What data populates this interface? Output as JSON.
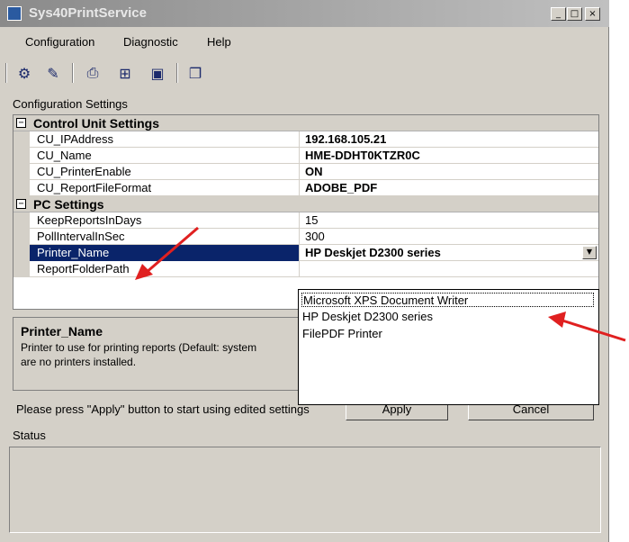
{
  "window": {
    "title": "Sys40PrintService"
  },
  "menu": [
    "Configuration",
    "Diagnostic",
    "Help"
  ],
  "toolbar": {
    "icons": [
      "settings-icon",
      "edit-icon",
      "print-icon",
      "network-icon",
      "device-icon",
      "report-icon"
    ]
  },
  "config": {
    "section_label": "Configuration Settings",
    "categories": [
      {
        "label": "Control Unit Settings",
        "toggle": "⊟",
        "properties": [
          {
            "name": "CU_IPAddress",
            "value": "192.168.105.21"
          },
          {
            "name": "CU_Name",
            "value": "HME-DDHT0KTZR0C"
          },
          {
            "name": "CU_PrinterEnable",
            "value": "ON"
          },
          {
            "name": "CU_ReportFileFormat",
            "value": "ADOBE_PDF"
          }
        ]
      },
      {
        "label": "PC Settings",
        "toggle": "⊟",
        "properties": [
          {
            "name": "KeepReportsInDays",
            "value": "15"
          },
          {
            "name": "PollIntervalInSec",
            "value": "300"
          },
          {
            "name": "Printer_Name",
            "value": "HP Deskjet D2300 series",
            "selected": true
          },
          {
            "name": "ReportFolderPath",
            "value": ""
          }
        ]
      }
    ]
  },
  "dropdown": {
    "options": [
      "Microsoft XPS Document Writer",
      "HP Deskjet D2300 series",
      "FilePDF Printer"
    ]
  },
  "description": {
    "title": "Printer_Name",
    "text_line1": "Printer to use for printing reports (Default: system",
    "text_line2": "are no printers installed."
  },
  "footer": {
    "apply_hint": "Please press \"Apply\" button to start using edited settings",
    "apply_label": "Apply",
    "cancel_label": "Cancel",
    "status_label": "Status"
  },
  "colors": {
    "selection": "#0a246a",
    "annotation_arrow": "#e02020"
  }
}
